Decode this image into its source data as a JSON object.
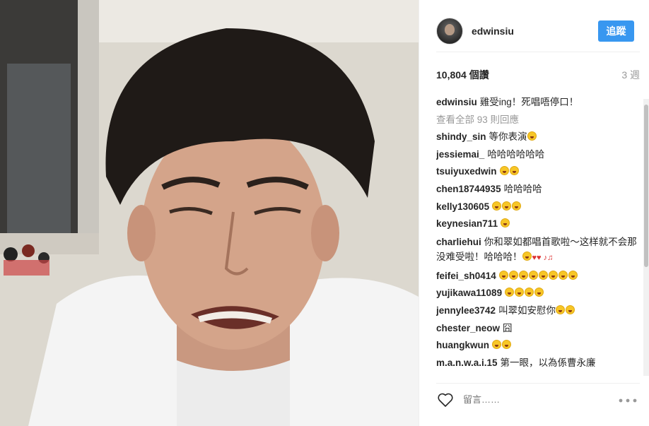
{
  "post": {
    "username": "edwinsiu",
    "follow_label": "追蹤",
    "likes": "10,804 個讚",
    "time_ago": "3 週",
    "caption_user": "edwinsiu",
    "caption_text": "雞受ing！死唱唔停口！",
    "view_all": "查看全部 93 則回應"
  },
  "comments": [
    {
      "user": "shindy_sin",
      "text": "等你表演",
      "emoji": 1
    },
    {
      "user": "jessiemai_",
      "text": "哈哈哈哈哈哈",
      "emoji": 0
    },
    {
      "user": "tsuiyuxedwin",
      "text": "",
      "emoji": 2
    },
    {
      "user": "chen18744935",
      "text": "哈哈哈哈",
      "emoji": 0
    },
    {
      "user": "kelly130605",
      "text": "",
      "emoji": 3
    },
    {
      "user": "keynesian711",
      "text": "",
      "emoji": 1
    },
    {
      "user": "charliehui",
      "text": "你和翠如都唱首歌啦～这样就不会那没难受啦！哈哈哈！",
      "emoji": 1,
      "multi": true
    },
    {
      "user": "feifei_sh0414",
      "text": "",
      "emoji": 8
    },
    {
      "user": "yujikawa11089",
      "text": "",
      "emoji": 4
    },
    {
      "user": "jennylee3742",
      "text": "叫翠如安慰你",
      "emoji": 2
    },
    {
      "user": "chester_neow",
      "text": "囧",
      "emoji": 0
    },
    {
      "user": "huangkwun",
      "text": "",
      "emoji": 2
    },
    {
      "user": "m.a.n.w.a.i.15",
      "text": "第一眼，以為係曹永廉",
      "emoji": 0
    }
  ],
  "footer": {
    "comment_placeholder": "留言……",
    "more_label": "…"
  },
  "icons": {
    "heart": "heart-icon",
    "more": "more-options-icon"
  },
  "colors": {
    "accent": "#3897f0",
    "muted": "#999999",
    "text": "#262626"
  }
}
